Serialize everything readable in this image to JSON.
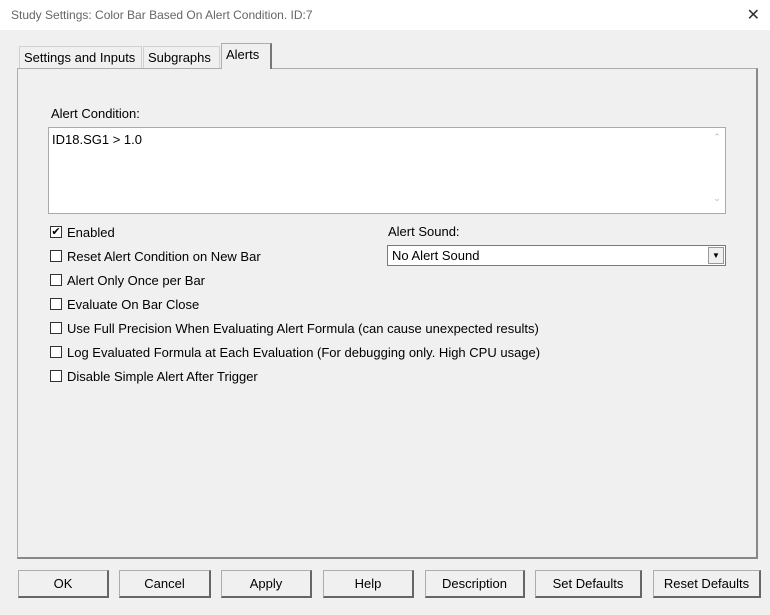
{
  "window": {
    "title": "Study Settings: Color Bar Based On Alert Condition. ID:7",
    "close": "✕"
  },
  "tabs": [
    {
      "label": "Settings and Inputs"
    },
    {
      "label": "Subgraphs"
    },
    {
      "label": "Alerts"
    }
  ],
  "alert_condition": {
    "label": "Alert Condition:",
    "value": "ID18.SG1 > 1.0"
  },
  "checkboxes": [
    {
      "label": "Enabled",
      "checked": true,
      "mark": "✔"
    },
    {
      "label": "Reset Alert Condition on New Bar",
      "checked": false
    },
    {
      "label": "Alert Only Once per Bar",
      "checked": false
    },
    {
      "label": "Evaluate On Bar Close",
      "checked": false
    },
    {
      "label": "Use Full Precision When Evaluating Alert Formula (can cause unexpected results)",
      "checked": false
    },
    {
      "label": "Log Evaluated Formula at Each Evaluation (For debugging only. High CPU usage)",
      "checked": false
    },
    {
      "label": "Disable Simple Alert After Trigger",
      "checked": false
    }
  ],
  "alert_sound": {
    "label": "Alert Sound:",
    "value": "No Alert Sound"
  },
  "buttons": {
    "ok": "OK",
    "cancel": "Cancel",
    "apply": "Apply",
    "help": "Help",
    "description": "Description",
    "set_defaults": "Set Defaults",
    "reset_defaults": "Reset Defaults"
  }
}
